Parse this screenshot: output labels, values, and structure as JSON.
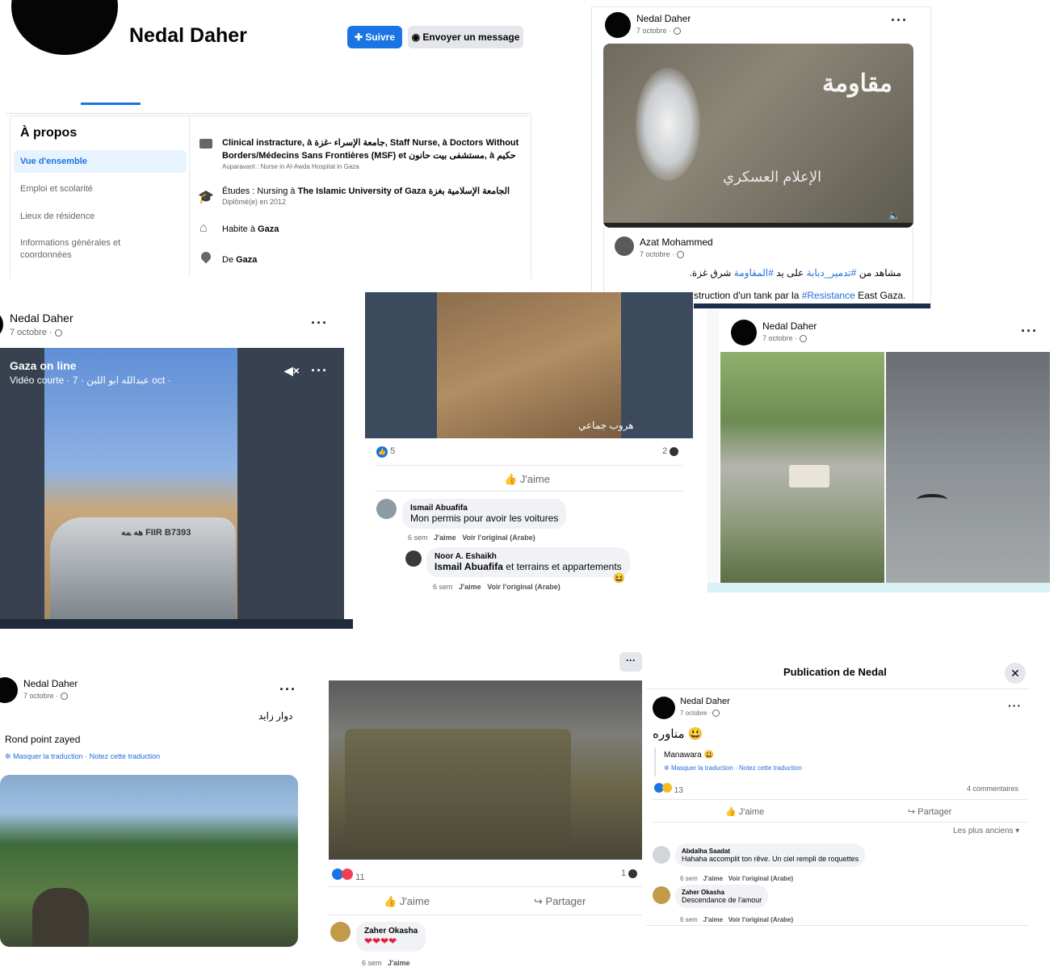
{
  "profile": {
    "name": "Nedal Daher",
    "follow_label": "Suivre",
    "message_label": "Envoyer un message"
  },
  "about": {
    "title": "À propos",
    "nav": [
      "Vue d'ensemble",
      "Emploi et scolarité",
      "Lieux de résidence",
      "Informations générales et coordonnées"
    ],
    "work_line1": "Clinical instracture, à جامعة الإسراء -غزة, Staff Nurse, à Doctors Without",
    "work_line2": "Borders/Médecins Sans Frontières (MSF) et مستشفى بيت حانون, à حكيم",
    "work_prev": "Auparavant : Nurse in Al-Awda Hospital in Gaza",
    "edu_prefix": "Études : Nursing à",
    "edu_school": "The Islamic University of Gaza الجامعة الإسلامية بغزة",
    "edu_sub": "Diplômé(e) en 2012",
    "lives_prefix": "Habite à",
    "lives_city": "Gaza",
    "from_prefix": "De",
    "from_city": "Gaza"
  },
  "post_top_right": {
    "author": "Nedal Daher",
    "date": "7 octobre ·",
    "video_watermark": "الإعلام العسكري",
    "video_logo": "مقاومة",
    "shared_author": "Azat Mohammed",
    "shared_date": "7 octobre ·",
    "ar_text_prefix": "مشاهد من",
    "ar_tag1": "#تدمير_دبابة",
    "ar_text_mid": "على يد",
    "ar_tag2": "#المقاومة",
    "ar_text_end": "شرق غزة.",
    "fr_text": "struction d'un tank par la",
    "fr_tag": "#Resistance",
    "fr_end": "East Gaza."
  },
  "post_mid_left": {
    "author": "Nedal Daher",
    "date": "7 octobre ·",
    "video_title": "Gaza on line",
    "video_sub": "Vidéo courte · 7 · عبدالله ابو اللبن oct ·",
    "plate": "ﻫﻪ ﻤﻪ FIIR B7393"
  },
  "post_mid_center": {
    "video_caption": "هروب جماعي",
    "likes": "5",
    "comments": "2",
    "like_label": "J'aime",
    "comment1": {
      "name": "Ismail Abuafifa",
      "text": "Mon permis pour avoir les voitures",
      "time": "6 sem",
      "like": "J'aime",
      "original": "Voir l'original (Arabe)"
    },
    "comment2": {
      "name": "Noor A. Eshaikh",
      "mention": "Ismail Abuafifa",
      "text": "et terrains et appartements",
      "time": "6 sem",
      "like": "J'aime",
      "original": "Voir l'original (Arabe)"
    }
  },
  "post_mid_right": {
    "author": "Nedal Daher",
    "date": "7 octobre ·"
  },
  "post_bottom_left": {
    "author": "Nedal Daher",
    "date": "7 octobre ·",
    "ar_text": "دوار زايد",
    "fr_text": "Rond point zayed",
    "translation_links": "Masquer la traduction · Notez cette traduction"
  },
  "post_bottom_center": {
    "reactions": "11",
    "comments": "1",
    "like_label": "J'aime",
    "share_label": "Partager",
    "comment": {
      "name": "Zaher Okasha",
      "text": "❤❤❤❤",
      "time": "6 sem",
      "like": "J'aime"
    }
  },
  "post_bottom_right": {
    "modal_title": "Publication de Nedal",
    "author": "Nedal Daher",
    "date": "7 octobre ·",
    "ar_text": "مناوره",
    "fr_text": "Manawara",
    "translation_links": "Masquer la traduction · Notez cette traduction",
    "reactions": "13",
    "comments": "4 commentaires",
    "like_label": "J'aime",
    "share_label": "Partager",
    "sort_label": "Les plus anciens",
    "comment1": {
      "name": "Abdalha Saadat",
      "text": "Hahaha accomplit ton rêve. Un ciel rempli de roquettes",
      "time": "6 sem",
      "like": "J'aime",
      "original": "Voir l'original (Arabe)"
    },
    "comment2": {
      "name": "Zaher Okasha",
      "text": "Descendance de l'amour",
      "time": "6 sem",
      "like": "J'aime",
      "original": "Voir l'original (Arabe)"
    }
  },
  "colors": {
    "brand_blue": "#1b74e4",
    "link_blue": "#216fdb",
    "muted_gray": "#65676b",
    "bubble_gray": "#f0f2f5"
  }
}
